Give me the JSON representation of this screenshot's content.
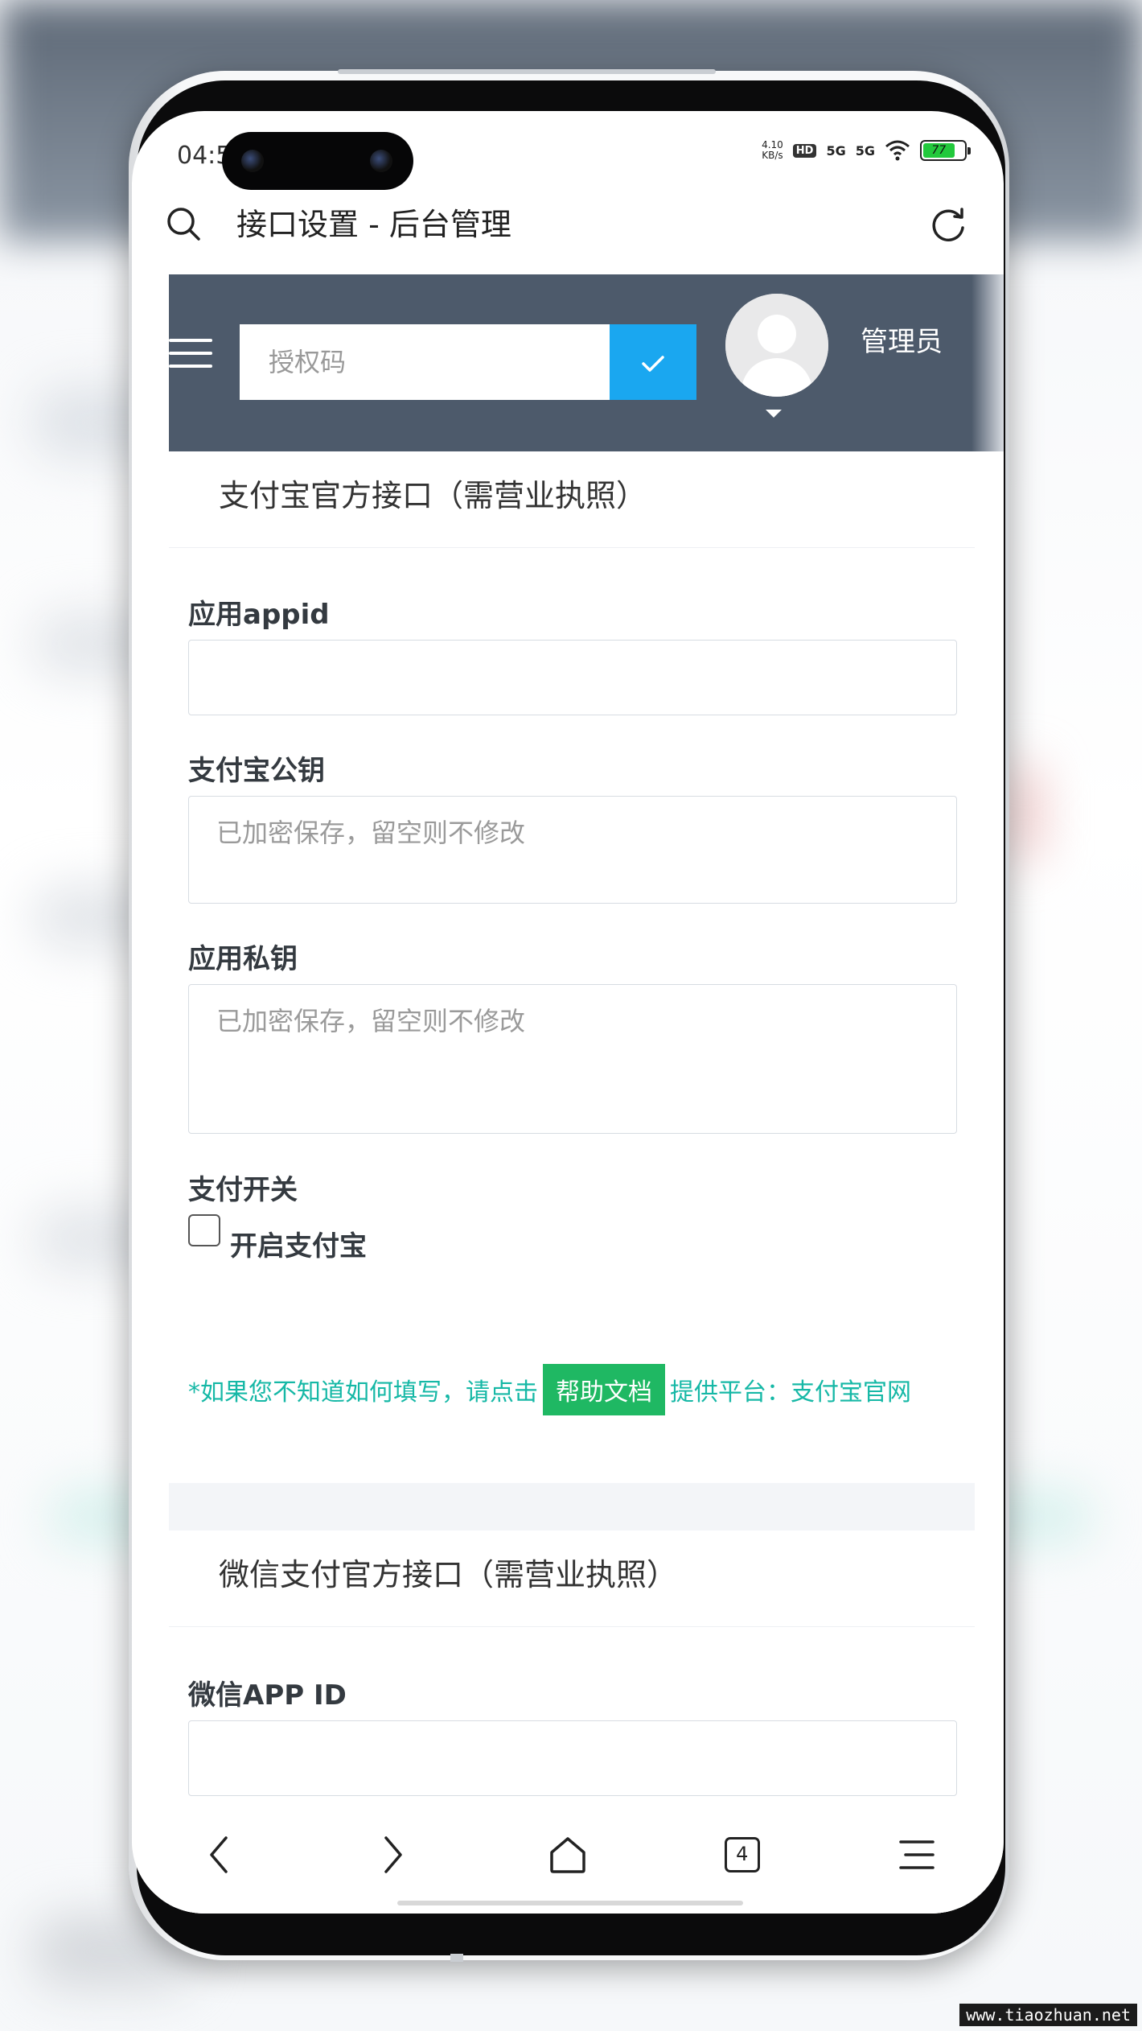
{
  "status_bar": {
    "time": "04:5",
    "net_speed": "4.10",
    "net_unit": "KB/s",
    "hd_label": "HD",
    "signal1": "5G",
    "signal2": "5G",
    "battery": "77"
  },
  "browser": {
    "page_title": "接口设置 - 后台管理",
    "tab_count": "4"
  },
  "header": {
    "auth_placeholder": "授权码",
    "confirm_icon": "check-icon",
    "admin_name": "管理员"
  },
  "alipay": {
    "title": "支付宝官方接口（需营业执照）",
    "appid_label": "应用appid",
    "appid_value": "",
    "pubkey_label": "支付宝公钥",
    "pubkey_placeholder": "已加密保存，留空则不修改",
    "privkey_label": "应用私钥",
    "privkey_placeholder": "已加密保存，留空则不修改",
    "switch_label": "支付开关",
    "enable_label": "开启支付宝",
    "enabled": false,
    "help_prefix": "*如果您不知道如何填写，请点击",
    "help_button": "帮助文档",
    "help_suffix": "提供平台：支付宝官网"
  },
  "wechat": {
    "title": "微信支付官方接口（需营业执照）",
    "appid_label": "微信APP ID",
    "appid_value": ""
  },
  "watermark": "www.tiaozhuan.net",
  "colors": {
    "header_bg": "#4d5a6b",
    "accent_blue": "#1aa7f0",
    "help_green": "#1fb863",
    "help_text": "#16b8a6"
  }
}
